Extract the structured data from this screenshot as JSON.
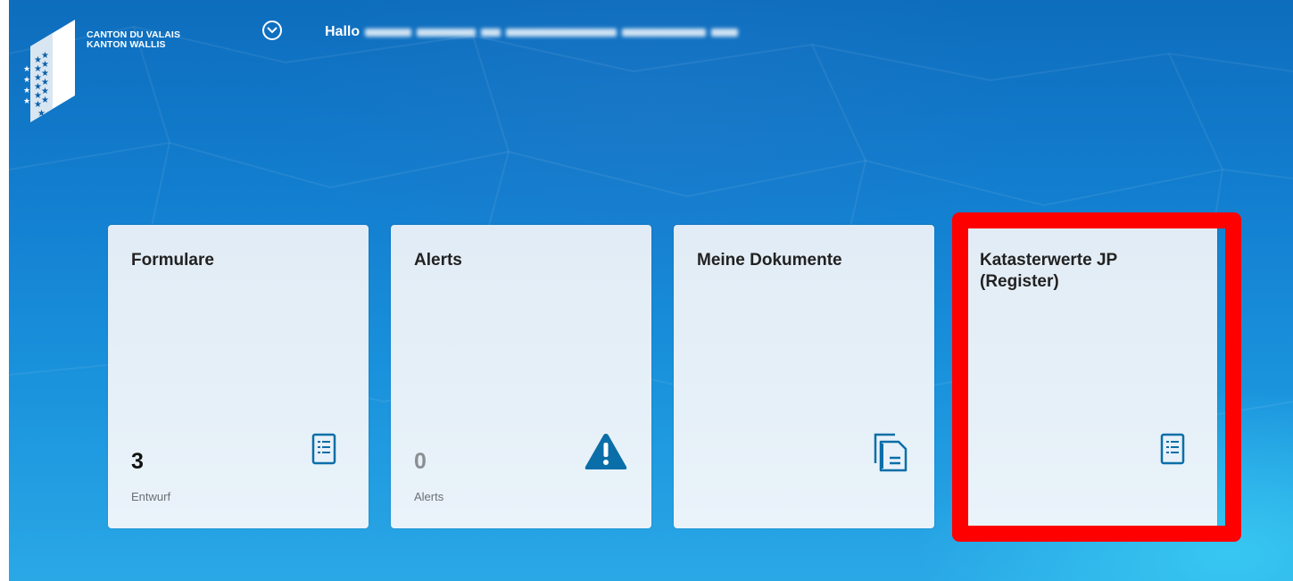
{
  "header": {
    "canton_line1": "CANTON DU VALAIS",
    "canton_line2": "KANTON WALLIS",
    "greeting_prefix": "Hallo",
    "menu_icon": "chevron-down-circle-icon"
  },
  "tiles": [
    {
      "title": "Formulare",
      "count": "3",
      "sub": "Entwurf",
      "icon": "form-list-icon"
    },
    {
      "title": "Alerts",
      "count": "0",
      "sub": "Alerts",
      "icon": "warning-triangle-icon"
    },
    {
      "title": "Meine Dokumente",
      "icon": "documents-icon"
    },
    {
      "title_line1": "Katasterwerte JP",
      "title_line2": "(Register)",
      "icon": "form-list-icon"
    }
  ],
  "colors": {
    "icon_blue": "#0a6ea8",
    "highlight": "#ff0000",
    "tile_bg": "#e4eef7"
  }
}
